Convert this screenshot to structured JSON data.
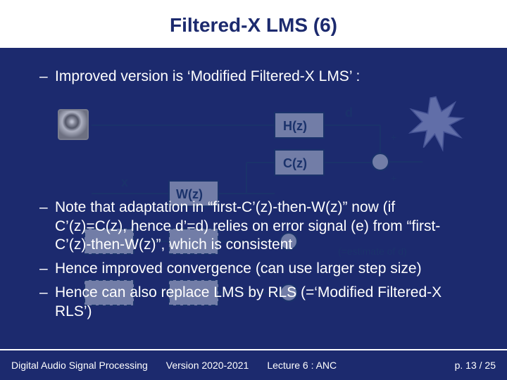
{
  "title": "Filtered-X LMS (6)",
  "bullets": [
    "Improved version is ‘Modified Filtered-X LMS’ :",
    "Note that adaptation in “first-C’(z)-then-W(z)” now (if C’(z)=C(z), hence d’=d) relies on error signal (e) from “first-C’(z)-then-W(z)”, which is consistent",
    "Hence improved convergence (can use larger step size)",
    "Hence can also replace LMS by RLS (=‘Modified Filtered-X RLS’)"
  ],
  "diagram": {
    "signals": {
      "x": "x",
      "d": "d",
      "sum_plus": "+",
      "sum_minus": "-",
      "note": "(=estimate of d)"
    },
    "blocks": {
      "H": "H(z)",
      "C": "C(z)",
      "W": "W(z)"
    }
  },
  "footer": {
    "course": "Digital Audio Signal Processing",
    "version": "Version 2020-2021",
    "lecture": "Lecture 6 : ANC",
    "page": "p. 13 / 25"
  }
}
